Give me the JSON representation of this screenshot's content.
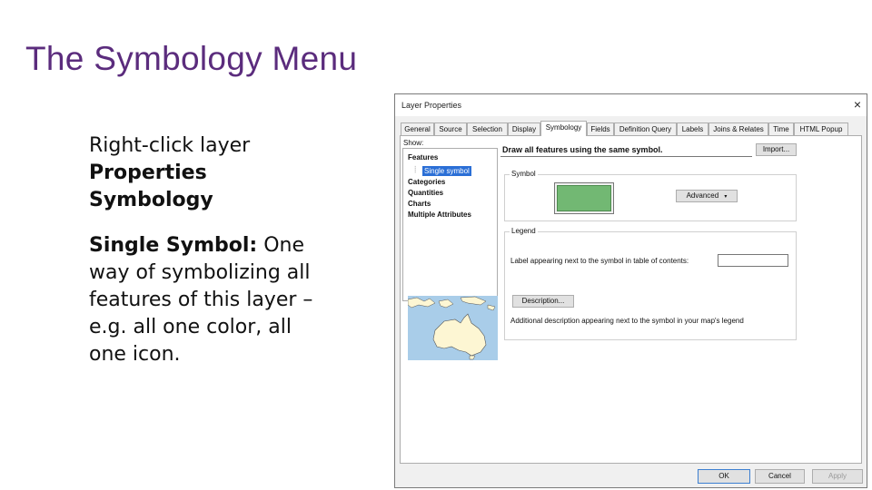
{
  "slide": {
    "title": "The Symbology Menu",
    "steps": [
      "Right-click layer",
      "Properties",
      "Symbology"
    ],
    "single_symbol_label": "Single Symbol:",
    "single_symbol_desc_1": " One",
    "single_symbol_desc_2": "way of symbolizing all",
    "single_symbol_desc_3": "features of this layer –",
    "single_symbol_desc_4": "e.g. all one color, all",
    "single_symbol_desc_5": "one icon."
  },
  "dialog": {
    "title": "Layer Properties",
    "close": "×",
    "tabs": [
      "General",
      "Source",
      "Selection",
      "Display",
      "Symbology",
      "Fields",
      "Definition Query",
      "Labels",
      "Joins & Relates",
      "Time",
      "HTML Popup"
    ],
    "active_tab": "Symbology",
    "show_label": "Show:",
    "tree": {
      "features": "Features",
      "single_symbol": "Single symbol",
      "categories": "Categories",
      "quantities": "Quantities",
      "charts": "Charts",
      "multiple_attributes": "Multiple Attributes"
    },
    "header": "Draw all features using the same symbol.",
    "import_button": "Import...",
    "symbol_group": "Symbol",
    "symbol_color": "#72b873",
    "advanced_button": "Advanced",
    "legend_group": "Legend",
    "legend_label_text": "Label appearing next to the symbol in table of contents:",
    "legend_label_value": "",
    "description_button": "Description...",
    "additional_desc": "Additional description appearing next to the symbol in your map's legend",
    "ok": "OK",
    "cancel": "Cancel",
    "apply": "Apply"
  }
}
